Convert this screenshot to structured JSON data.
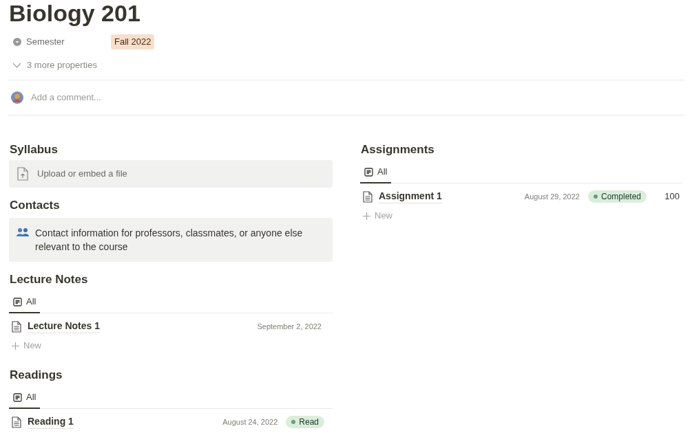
{
  "title": "Biology 201",
  "properties": [
    {
      "name": "Semester",
      "value": "Fall 2022",
      "color": "#f8dfcc"
    }
  ],
  "more_properties": "3 more properties",
  "comment": {
    "placeholder": "Add a comment..."
  },
  "columns": [
    {
      "sections": [
        {
          "kind": "file",
          "heading": "Syllabus",
          "text": "Upload or embed a file"
        },
        {
          "kind": "callout",
          "heading": "Contacts",
          "text": "Contact information for professors, classmates, or anyone else relevant to the course"
        },
        {
          "kind": "database",
          "heading": "Lecture Notes",
          "views": [
            {
              "label": "All",
              "selected": true
            }
          ],
          "rows": [
            {
              "title": "Lecture Notes 1",
              "date": "September 2, 2022"
            }
          ],
          "new_label": "New"
        },
        {
          "kind": "database",
          "heading": "Readings",
          "views": [
            {
              "label": "All",
              "selected": true
            }
          ],
          "rows": [
            {
              "title": "Reading 1",
              "date": "August 24, 2022",
              "status": {
                "label": "Read",
                "color": "#dbeddb"
              }
            }
          ]
        }
      ]
    },
    {
      "sections": [
        {
          "kind": "database",
          "heading": "Assignments",
          "views": [
            {
              "label": "All",
              "selected": true
            }
          ],
          "rows": [
            {
              "title": "Assignment 1",
              "date": "August 29, 2022",
              "status": {
                "label": "Completed",
                "color": "#dbeddb"
              },
              "score": "100"
            }
          ],
          "new_label": "New"
        }
      ]
    }
  ]
}
